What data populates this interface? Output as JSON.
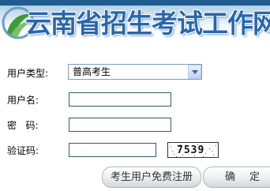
{
  "banner": {
    "title": "云南省招生考试工作网"
  },
  "form": {
    "user_type_label": "用户类型:",
    "user_type_value": "普高考生",
    "username_label": "用户名:",
    "username_value": "",
    "password_label": "密   码:",
    "password_value": "",
    "captcha_label": "验证码:",
    "captcha_value": "",
    "captcha_image_text": "7539"
  },
  "buttons": {
    "register_label": "考生用户免费注册",
    "confirm_label": "确定"
  },
  "colors": {
    "banner_title": "#2a66a8",
    "banner_top": "#1e5d8e",
    "input_border": "#2f5e5e"
  }
}
